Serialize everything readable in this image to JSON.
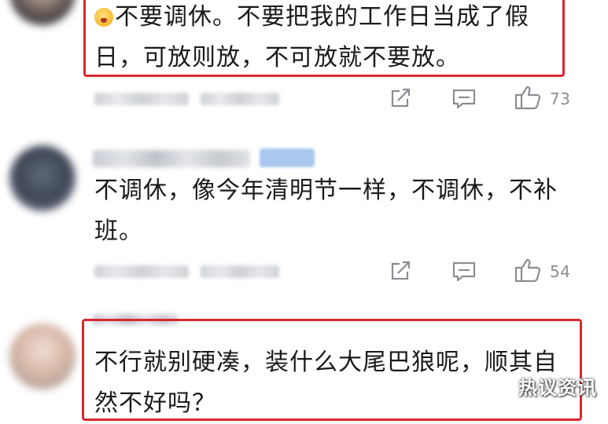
{
  "comments": [
    {
      "emoji": "scared-face-icon",
      "text": "不要调休。不要把我的工作日当成了假日，可放则放，不可放就不要放。",
      "likes": "73",
      "highlighted": true
    },
    {
      "text": "不调休，像今年清明节一样，不调休，不补班。",
      "likes": "54",
      "highlighted": false
    },
    {
      "text": "不行就别硬凑，装什么大尾巴狼呢，顺其自然不好吗？",
      "highlighted": true
    }
  ],
  "watermark": "热议资讯",
  "colors": {
    "highlight_border": "#d9272e",
    "icon_gray": "#8a8d93"
  }
}
